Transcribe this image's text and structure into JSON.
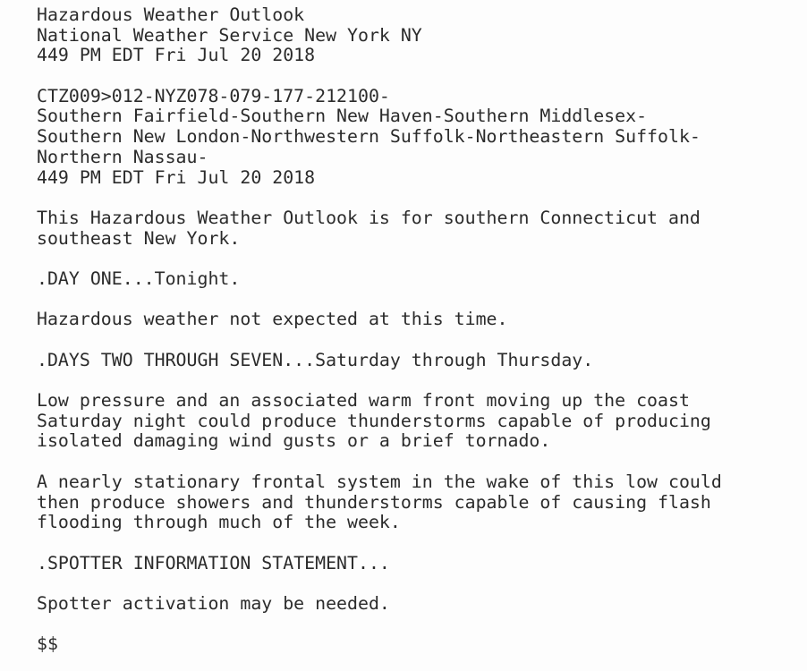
{
  "document": {
    "type": "nws-text-product",
    "product_title": "Hazardous Weather Outlook",
    "issuing_office": "National Weather Service New York NY",
    "issuance_time": "449 PM EDT Fri Jul 20 2018",
    "ugc_zone_code_line": "CTZ009>012-NYZ078-079-177-212100-",
    "zone_names": [
      "Southern Fairfield-Southern New Haven-Southern Middlesex-",
      "Southern New London-Northwestern Suffolk-Northeastern Suffolk-",
      "Northern Nassau-"
    ],
    "segment_time": "449 PM EDT Fri Jul 20 2018",
    "intro": [
      "This Hazardous Weather Outlook is for southern Connecticut and",
      "southeast New York."
    ],
    "sections": [
      {
        "heading": ".DAY ONE...Tonight.",
        "body": [
          "Hazardous weather not expected at this time."
        ]
      },
      {
        "heading": ".DAYS TWO THROUGH SEVEN...Saturday through Thursday.",
        "body": [
          "Low pressure and an associated warm front moving up the coast",
          "Saturday night could produce thunderstorms capable of producing",
          "isolated damaging wind gusts or a brief tornado.",
          "",
          "A nearly stationary frontal system in the wake of this low could",
          "then produce showers and thunderstorms capable of causing flash",
          "flooding through much of the week."
        ]
      },
      {
        "heading": ".SPOTTER INFORMATION STATEMENT...",
        "body": [
          "Spotter activation may be needed."
        ]
      }
    ],
    "terminator": "$$",
    "colors": {
      "background": "#fdfdfd",
      "text": "#2b2b2b"
    },
    "lines": [
      "Hazardous Weather Outlook",
      "National Weather Service New York NY",
      "449 PM EDT Fri Jul 20 2018",
      "",
      "CTZ009>012-NYZ078-079-177-212100-",
      "Southern Fairfield-Southern New Haven-Southern Middlesex-",
      "Southern New London-Northwestern Suffolk-Northeastern Suffolk-",
      "Northern Nassau-",
      "449 PM EDT Fri Jul 20 2018",
      "",
      "This Hazardous Weather Outlook is for southern Connecticut and",
      "southeast New York.",
      "",
      ".DAY ONE...Tonight.",
      "",
      "Hazardous weather not expected at this time.",
      "",
      ".DAYS TWO THROUGH SEVEN...Saturday through Thursday.",
      "",
      "Low pressure and an associated warm front moving up the coast",
      "Saturday night could produce thunderstorms capable of producing",
      "isolated damaging wind gusts or a brief tornado.",
      "",
      "A nearly stationary frontal system in the wake of this low could",
      "then produce showers and thunderstorms capable of causing flash",
      "flooding through much of the week.",
      "",
      ".SPOTTER INFORMATION STATEMENT...",
      "",
      "Spotter activation may be needed.",
      "",
      "$$"
    ]
  }
}
